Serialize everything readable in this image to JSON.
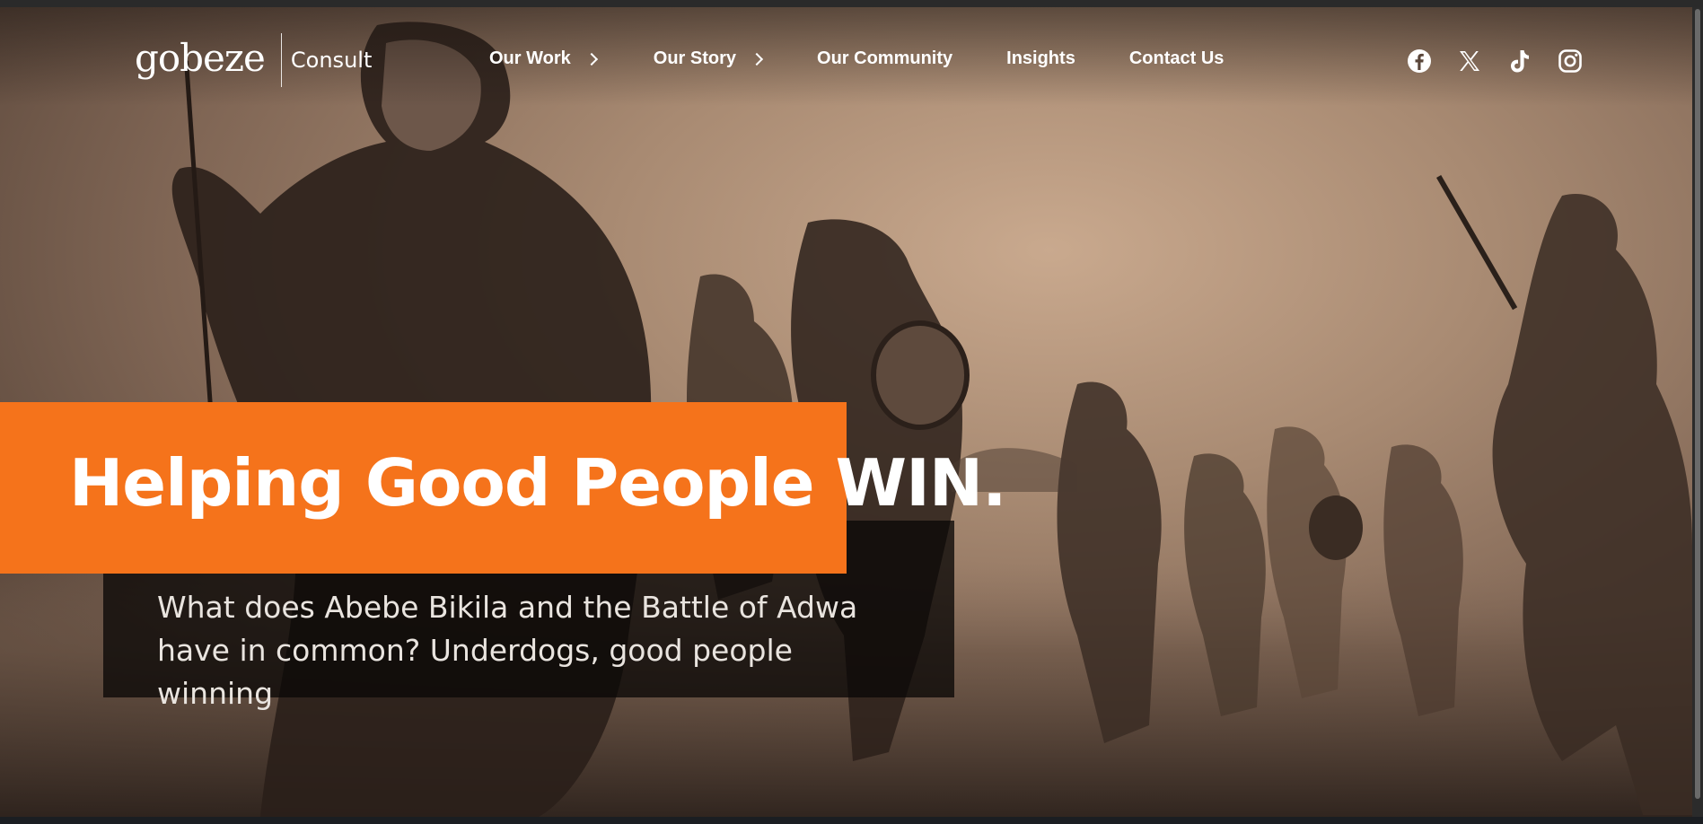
{
  "brand": {
    "logo_word": "gobeze",
    "logo_sub": "Consult"
  },
  "nav": {
    "items": [
      {
        "label": "Our Work",
        "has_submenu": true
      },
      {
        "label": "Our Story",
        "has_submenu": true
      },
      {
        "label": "Our Community",
        "has_submenu": false
      },
      {
        "label": "Insights",
        "has_submenu": false
      },
      {
        "label": "Contact Us",
        "has_submenu": false
      }
    ]
  },
  "social": {
    "icons": [
      "facebook-icon",
      "x-icon",
      "tiktok-icon",
      "instagram-icon"
    ]
  },
  "hero": {
    "headline": "Helping Good People WIN.",
    "subtext": "What does Abebe Bikila and the Battle of Adwa have in common? Underdogs, good people winning"
  },
  "colors": {
    "accent": "#f5731b",
    "text_light": "#ffffff",
    "overlay_dark": "#0a0807"
  }
}
